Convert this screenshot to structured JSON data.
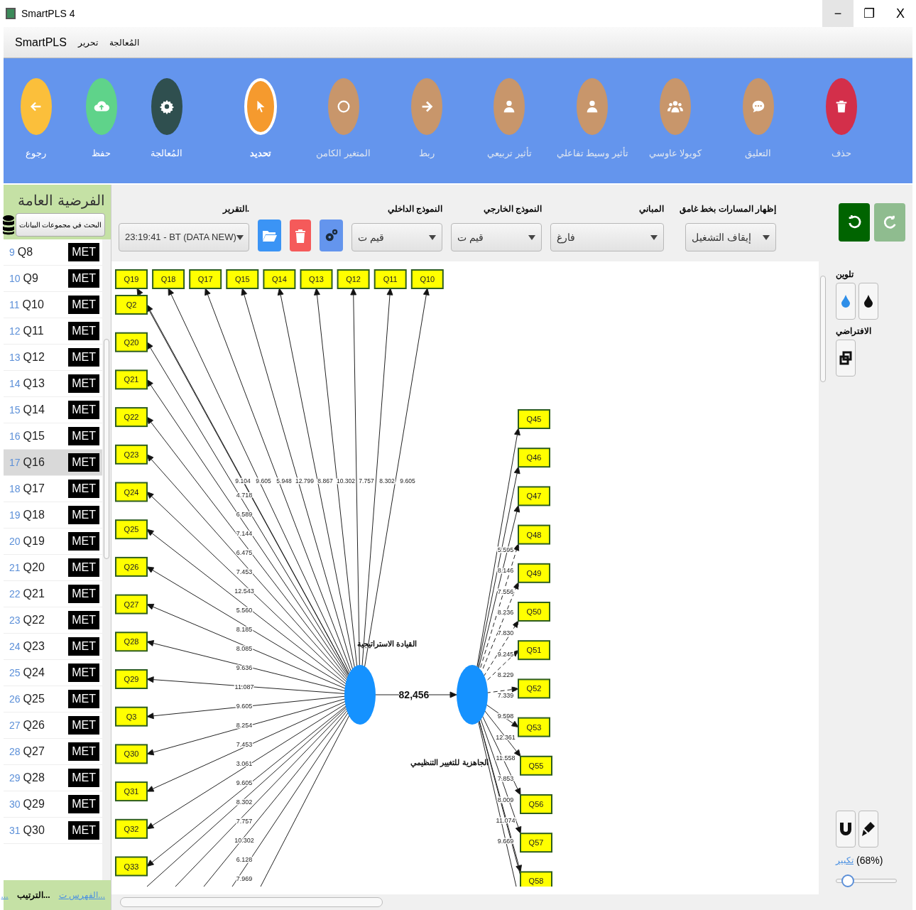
{
  "window": {
    "title": "SmartPLS 4",
    "controls": [
      "−",
      "❐",
      "X"
    ]
  },
  "menu": [
    "المُعالجة",
    "تحرير",
    "SmartPLS"
  ],
  "toolbar": [
    {
      "label": "حذف",
      "kind": "trash",
      "color": "#d32f4a",
      "selected": false,
      "disabled": true
    },
    {
      "label": "التعليق",
      "kind": "comment",
      "color": "#c8966b",
      "selected": false,
      "disabled": true
    },
    {
      "label": "كويولا عاوسي",
      "kind": "users",
      "color": "#c8966b",
      "selected": false,
      "disabled": true
    },
    {
      "label": "تأثير وسيط تفاعلي",
      "kind": "user",
      "color": "#c8966b",
      "selected": false,
      "disabled": true
    },
    {
      "label": "تأثير تربيعي",
      "kind": "user",
      "color": "#c8966b",
      "selected": false,
      "disabled": true
    },
    {
      "label": "ربط",
      "kind": "arrow",
      "color": "#c8966b",
      "selected": false,
      "disabled": true
    },
    {
      "label": "المتغير الكامن",
      "kind": "circle",
      "color": "#c8966b",
      "selected": false,
      "disabled": true
    },
    {
      "label": "تحديد",
      "kind": "pointer",
      "color": "#f59a2e",
      "selected": true,
      "disabled": false
    },
    {
      "label": "المُعالجة",
      "kind": "gear",
      "color": "#2f4f4f",
      "selected": false,
      "disabled": false
    },
    {
      "label": "حفظ",
      "kind": "save",
      "color": "#5fd38a",
      "selected": false,
      "disabled": false
    },
    {
      "label": "رجوع",
      "kind": "back",
      "color": "#fbbf3b",
      "selected": false,
      "disabled": false
    }
  ],
  "sidebar": {
    "title": "الفرضية العامة",
    "search_button": "البحث في مجموعات البيانات",
    "items": [
      {
        "index": "9",
        "name": "Q8",
        "tag": "MET",
        "selected": false
      },
      {
        "index": "10",
        "name": "Q9",
        "tag": "MET",
        "selected": false
      },
      {
        "index": "11",
        "name": "Q10",
        "tag": "MET",
        "selected": false
      },
      {
        "index": "12",
        "name": "Q11",
        "tag": "MET",
        "selected": false
      },
      {
        "index": "13",
        "name": "Q12",
        "tag": "MET",
        "selected": false
      },
      {
        "index": "14",
        "name": "Q13",
        "tag": "MET",
        "selected": false
      },
      {
        "index": "15",
        "name": "Q14",
        "tag": "MET",
        "selected": false
      },
      {
        "index": "16",
        "name": "Q15",
        "tag": "MET",
        "selected": false
      },
      {
        "index": "17",
        "name": "Q16",
        "tag": "MET",
        "selected": true
      },
      {
        "index": "18",
        "name": "Q17",
        "tag": "MET",
        "selected": false
      },
      {
        "index": "19",
        "name": "Q18",
        "tag": "MET",
        "selected": false
      },
      {
        "index": "20",
        "name": "Q19",
        "tag": "MET",
        "selected": false
      },
      {
        "index": "21",
        "name": "Q20",
        "tag": "MET",
        "selected": false
      },
      {
        "index": "22",
        "name": "Q21",
        "tag": "MET",
        "selected": false
      },
      {
        "index": "23",
        "name": "Q22",
        "tag": "MET",
        "selected": false
      },
      {
        "index": "24",
        "name": "Q23",
        "tag": "MET",
        "selected": false
      },
      {
        "index": "25",
        "name": "Q24",
        "tag": "MET",
        "selected": false
      },
      {
        "index": "26",
        "name": "Q25",
        "tag": "MET",
        "selected": false
      },
      {
        "index": "27",
        "name": "Q26",
        "tag": "MET",
        "selected": false
      },
      {
        "index": "28",
        "name": "Q27",
        "tag": "MET",
        "selected": false
      },
      {
        "index": "29",
        "name": "Q28",
        "tag": "MET",
        "selected": false
      },
      {
        "index": "30",
        "name": "Q29",
        "tag": "MET",
        "selected": false
      },
      {
        "index": "31",
        "name": "Q30",
        "tag": "MET",
        "selected": false
      }
    ],
    "footer": {
      "index_link": "الفهرس ت...",
      "sort_label": "الترتيب...",
      "more_link": "..."
    }
  },
  "report": {
    "label": "التقرير.",
    "value": "23:19:41 - BT (DATA NEW)"
  },
  "selects": [
    {
      "label": "إظهار المسارات بخط غامق",
      "value": "إيقاف التشغيل"
    },
    {
      "label": "المباني",
      "value": "فارغ"
    },
    {
      "label": "النموذج الخارجي",
      "value": "قيم ت"
    },
    {
      "label": "النموذج الداخلي",
      "value": "قيم ت"
    }
  ],
  "model": {
    "constructs": [
      {
        "label": "القيادة الاستراتيجية"
      },
      {
        "label": "الجاهزية للتغيير التنظيمي"
      }
    ],
    "path_coefficient": "82,456",
    "top_indicators": [
      "Q19",
      "Q18",
      "Q17",
      "Q15",
      "Q14",
      "Q13",
      "Q12",
      "Q11",
      "Q10"
    ],
    "top_weights": [
      "9.104",
      "9.605",
      "5.948",
      "12.799",
      "8.867",
      "10.302",
      "7.757",
      "8.302",
      "9.605"
    ],
    "left_indicators": [
      "Q2",
      "Q20",
      "Q21",
      "Q22",
      "Q23",
      "Q24",
      "Q25",
      "Q26",
      "Q27",
      "Q28",
      "Q29",
      "Q3",
      "Q30",
      "Q31",
      "Q32",
      "Q33"
    ],
    "left_weights": [
      "4.718",
      "6.589",
      "7.144",
      "6.475",
      "7.453",
      "12.543",
      "5.560",
      "8.185",
      "8.085",
      "9.636",
      "11.087",
      "9.605",
      "8.254",
      "7.453",
      "3.061",
      "9.605",
      "8.302",
      "7.757",
      "10.302",
      "6.128",
      "7.969"
    ],
    "right_indicators": [
      "Q45",
      "Q46",
      "Q47",
      "Q48",
      "Q49",
      "Q50",
      "Q51",
      "Q52",
      "Q53",
      "Q55",
      "Q56",
      "Q57",
      "Q58"
    ],
    "right_weights": [
      "5.595",
      "8.146",
      "7.556",
      "8.236",
      "7.830",
      "9.245",
      "8.229",
      "7.339",
      "9.598",
      "12.361",
      "11.558",
      "7.853",
      "8.009",
      "11.074",
      "9.669"
    ]
  },
  "right_panel": {
    "color_label": "تلوين",
    "default_label": "الافتراضي",
    "zoom_link": "تكبير",
    "zoom_value": "(68%)",
    "zoom": {
      "level": 0.12
    },
    "redo_disabled": true
  }
}
